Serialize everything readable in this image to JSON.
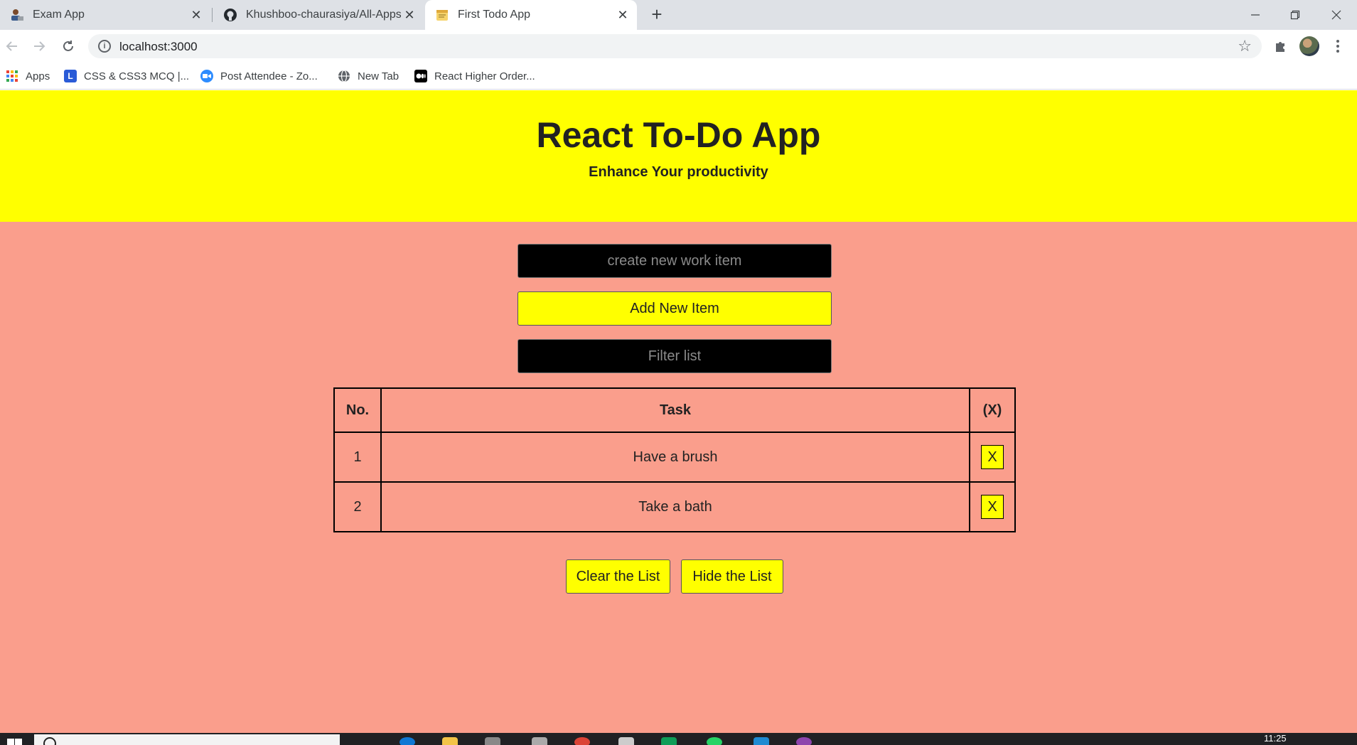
{
  "browser": {
    "tabs": [
      {
        "title": "Exam App",
        "icon": "person-laptop-icon",
        "active": false
      },
      {
        "title": "Khushboo-chaurasiya/All-Apps-T",
        "icon": "github-icon",
        "active": false
      },
      {
        "title": "First Todo App",
        "icon": "notes-icon",
        "active": true
      }
    ],
    "new_tab_label": "+",
    "window_controls": [
      "minimize-icon",
      "restore-icon",
      "close-icon"
    ],
    "url": "localhost:3000",
    "bookmarks": [
      {
        "label": "Apps",
        "icon": "apps-grid-icon"
      },
      {
        "label": "CSS & CSS3 MCQ |...",
        "icon": "letter-l-icon"
      },
      {
        "label": "Post Attendee - Zo...",
        "icon": "zoom-video-icon"
      },
      {
        "label": "New Tab",
        "icon": "globe-icon"
      },
      {
        "label": "React Higher Order...",
        "icon": "medium-icon"
      }
    ]
  },
  "app": {
    "title": "React To-Do App",
    "subtitle": "Enhance Your productivity",
    "new_item_placeholder": "create new work item",
    "add_button": "Add New Item",
    "filter_placeholder": "Filter list",
    "table": {
      "headers": [
        "No.",
        "Task",
        "(X)"
      ],
      "rows": [
        {
          "no": "1",
          "task": "Have a brush",
          "delete": "X"
        },
        {
          "no": "2",
          "task": "Take a bath",
          "delete": "X"
        }
      ]
    },
    "clear_button": "Clear the List",
    "hide_button": "Hide the List"
  },
  "taskbar": {
    "clock": "11:25"
  },
  "colors": {
    "header_bg": "#ffff00",
    "page_bg": "#fa9e8c",
    "button_bg": "#ffff00",
    "input_bg": "#000000"
  }
}
